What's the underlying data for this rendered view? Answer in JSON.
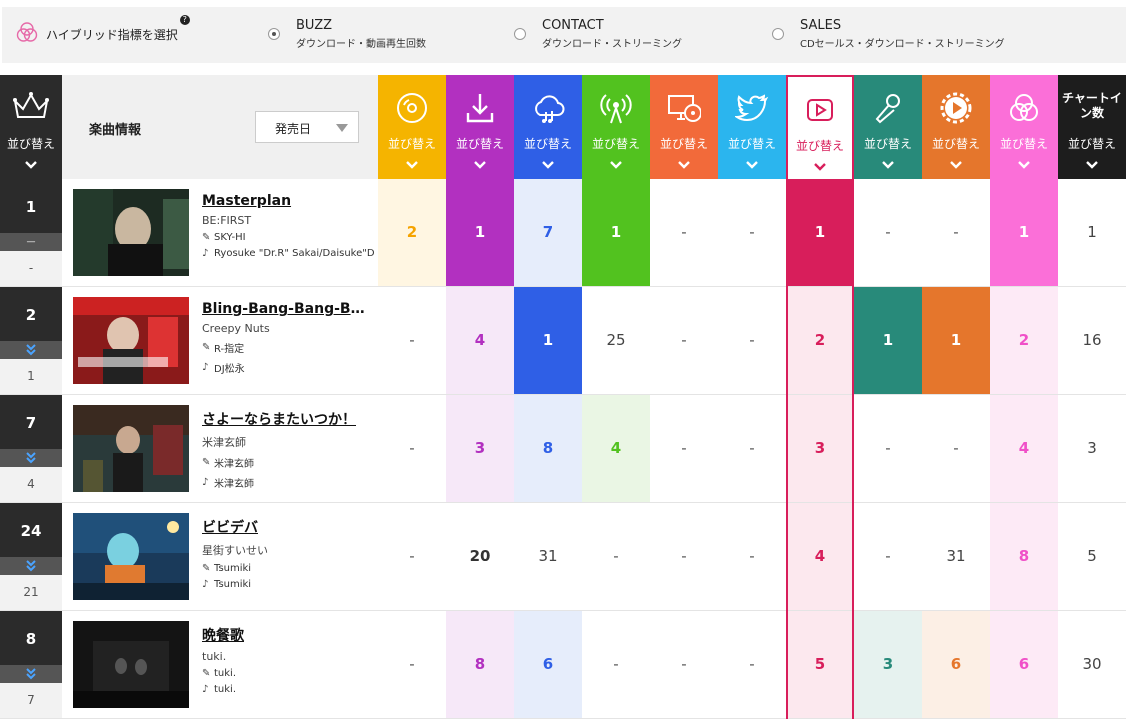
{
  "selector": {
    "label": "ハイブリッド指標を選択",
    "help": "?",
    "options": [
      {
        "name": "BUZZ",
        "desc": "ダウンロード・動画再生回数",
        "selected": true
      },
      {
        "name": "CONTACT",
        "desc": "ダウンロード・ストリーミング",
        "selected": false
      },
      {
        "name": "SALES",
        "desc": "CDセールス・ダウンロード・ストリーミング",
        "selected": false
      }
    ]
  },
  "header": {
    "rank_sort": "並び替え",
    "info_title": "楽曲情報",
    "sort_select": "発売日",
    "chart_in": "チャートイン数",
    "chart_in_sort": "並び替え",
    "columns": [
      {
        "icon": "cd-icon",
        "label": "並び替え",
        "bg": "#F5B400",
        "light": "#FFF6E2",
        "strong": "#F5B400",
        "text": "#F5A300"
      },
      {
        "icon": "download-icon",
        "label": "並び替え",
        "bg": "#B230C0",
        "light": "#F6E8F8",
        "strong": "#B230C0",
        "text": "#B230C0"
      },
      {
        "icon": "cloud-music-icon",
        "label": "並び替え",
        "bg": "#2F5FE6",
        "light": "#E6EDFB",
        "strong": "#2F5FE6",
        "text": "#2F5FE6"
      },
      {
        "icon": "radio-broadcast-icon",
        "label": "並び替え",
        "bg": "#52C21F",
        "light": "#EAF6E4",
        "strong": "#52C21F",
        "text": "#52C21F"
      },
      {
        "icon": "pc-cd-icon",
        "label": "並び替え",
        "bg": "#F26A3A",
        "light": "#FDEDE6",
        "strong": "#F26A3A",
        "text": "#F26A3A"
      },
      {
        "icon": "twitter-icon",
        "label": "並び替え",
        "bg": "#2BB5EE",
        "light": "#E4F5FC",
        "strong": "#2BB5EE",
        "text": "#2BB5EE"
      },
      {
        "icon": "youtube-play-icon",
        "label": "並び替え",
        "bg": "#FFFFFF",
        "light": "#FCE8EE",
        "strong": "#D81E5B",
        "text": "#D81E5B"
      },
      {
        "icon": "microphone-icon",
        "label": "並び替え",
        "bg": "#288A7A",
        "light": "#E6F2EF",
        "strong": "#288A7A",
        "text": "#288A7A"
      },
      {
        "icon": "play-gear-icon",
        "label": "並び替え",
        "bg": "#E5762C",
        "light": "#FCEFE5",
        "strong": "#E5762C",
        "text": "#E5762C"
      },
      {
        "icon": "hybrid-circles-icon",
        "label": "並び替え",
        "bg": "#FB6FD8",
        "light": "#FDEAF6",
        "strong": "#FB6FD8",
        "text": "#F050C8"
      }
    ]
  },
  "rows": [
    {
      "rank": "1",
      "move": "—",
      "prev": "-",
      "title": "Masterplan",
      "artist": "BE:FIRST",
      "lyricist": "SKY-HI",
      "composer": "Ryosuke \"Dr.R\" Sakai/Daisuke\"DAIS\"Miyachi",
      "cells": [
        "2",
        "1",
        "7",
        "1",
        "-",
        "-",
        "1",
        "-",
        "-",
        "1"
      ],
      "chart_in": "1"
    },
    {
      "rank": "2",
      "move": "down",
      "prev": "1",
      "title": "Bling-Bang-Bang-Born",
      "artist": "Creepy Nuts",
      "lyricist": "R-指定",
      "composer": "DJ松永",
      "cells": [
        "-",
        "4",
        "1",
        "25",
        "-",
        "-",
        "2",
        "1",
        "1",
        "2"
      ],
      "chart_in": "16"
    },
    {
      "rank": "7",
      "move": "down",
      "prev": "4",
      "title": "さよーならまたいつか！",
      "artist": "米津玄師",
      "lyricist": "米津玄師",
      "composer": "米津玄師",
      "cells": [
        "-",
        "3",
        "8",
        "4",
        "-",
        "-",
        "3",
        "-",
        "-",
        "4"
      ],
      "chart_in": "3"
    },
    {
      "rank": "24",
      "move": "down",
      "prev": "21",
      "title": "ビビデバ",
      "artist": "星街すいせい",
      "lyricist": "Tsumiki",
      "composer": "Tsumiki",
      "cells": [
        "-",
        "20",
        "31",
        "-",
        "-",
        "-",
        "4",
        "-",
        "31",
        "8"
      ],
      "chart_in": "5"
    },
    {
      "rank": "8",
      "move": "down",
      "prev": "7",
      "title": "晩餐歌",
      "artist": "tuki.",
      "lyricist": "tuki.",
      "composer": "tuki.",
      "cells": [
        "-",
        "8",
        "6",
        "-",
        "-",
        "-",
        "5",
        "3",
        "6",
        "6"
      ],
      "chart_in": "30"
    }
  ]
}
